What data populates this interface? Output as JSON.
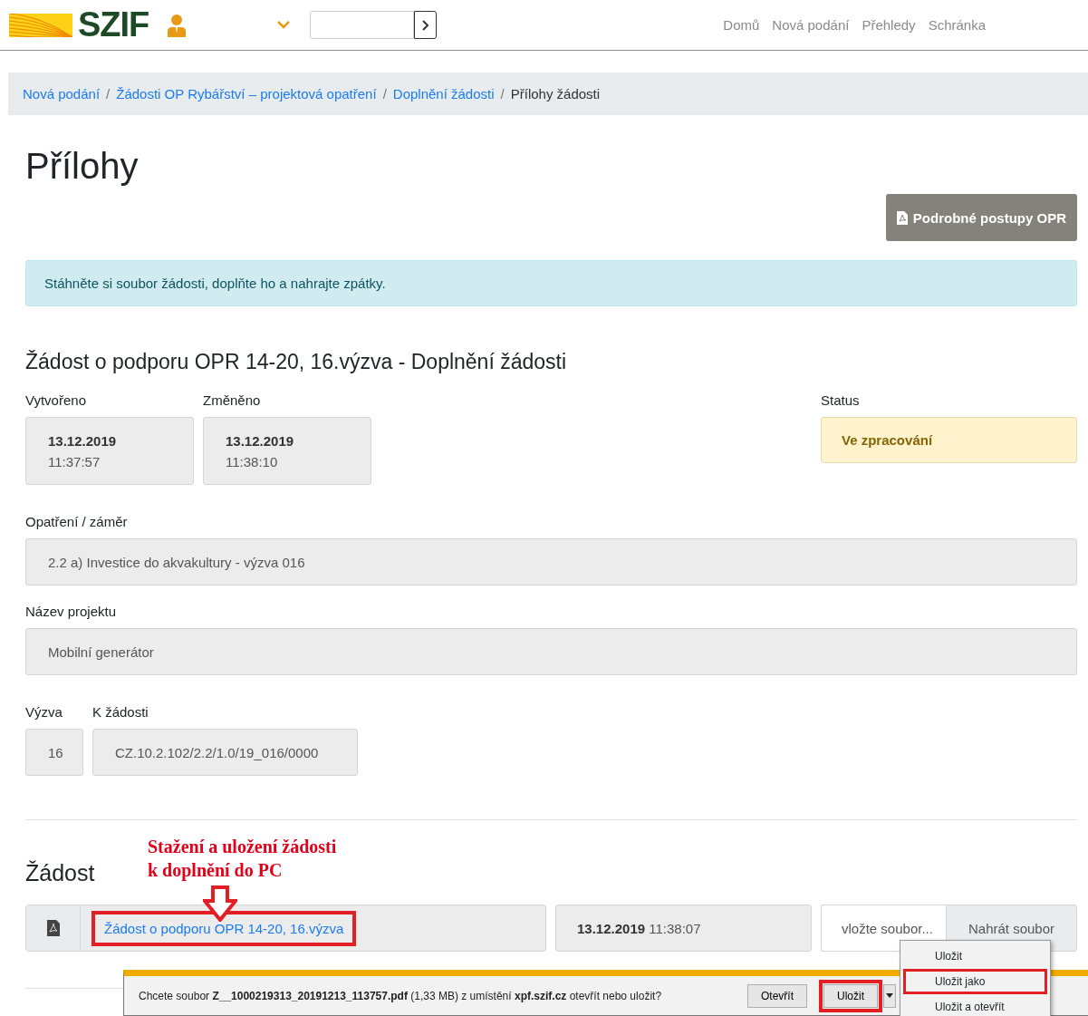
{
  "header": {
    "logo_text": "SZIF",
    "nav": [
      "Domů",
      "Nová podání",
      "Přehledy",
      "Schránka"
    ]
  },
  "breadcrumb": [
    {
      "label": "Nová podání",
      "current": false
    },
    {
      "separator": "/",
      "label": "Žádosti OP Rybářství – projektová opatření",
      "current": false
    },
    {
      "separator": "/",
      "label": "Doplnění žádosti",
      "current": false
    },
    {
      "separator": "/",
      "label": "Přílohy žádosti",
      "current": true
    }
  ],
  "title": "Přílohy",
  "guide_button": "Podrobné postupy OPR",
  "alert": "Stáhněte si soubor žádosti, doplňte ho a nahrajte zpátky.",
  "form": {
    "heading": "Žádost o podporu OPR 14-20, 16.výzva - Doplnění žádosti",
    "created": {
      "label": "Vytvořeno",
      "date": "13.12.2019",
      "time": "11:37:57"
    },
    "changed": {
      "label": "Změněno",
      "date": "13.12.2019",
      "time": "11:38:10"
    },
    "status": {
      "label": "Status",
      "value": "Ve zpracování"
    },
    "measure": {
      "label": "Opatření / záměr",
      "value": "2.2 a) Investice do akvakultury - výzva 016"
    },
    "project": {
      "label": "Název projektu",
      "value": "Mobilní generátor"
    },
    "call": {
      "label": "Výzva",
      "value": "16"
    },
    "request": {
      "label": "K žádosti",
      "value": "CZ.10.2.102/2.2/1.0/19_016/0000"
    }
  },
  "attachment": {
    "heading": "Žádost",
    "file_link": "Žádost o podporu OPR 14-20, 16.výzva",
    "link_highlighted": true,
    "date": "13.12.2019",
    "time": "11:38:07",
    "file_placeholder": "vložte soubor...",
    "upload_button": "Nahrát soubor"
  },
  "annotation": {
    "lines": [
      "Stažení a uložení žádosti",
      "k doplnění do PC"
    ]
  },
  "download_bar": {
    "message": "Chcete soubor **Z__1000219313_20191213_113757.pdf** (1,33 MB) z umístění **xpf.szif.cz** otevřít nebo uložit?",
    "buttons": [
      {
        "label": "Otevřít",
        "highlighted": false
      },
      {
        "label": "Uložit",
        "highlighted": true
      }
    ],
    "menu": [
      {
        "label": "Uložit",
        "highlighted": false
      },
      {
        "label": "Uložit jako",
        "highlighted": true
      },
      {
        "label": "Uložit a otevřít",
        "highlighted": false
      }
    ]
  }
}
